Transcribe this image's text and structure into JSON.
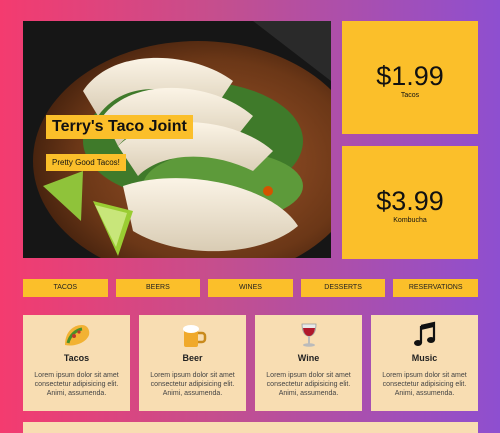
{
  "hero": {
    "title": "Terry's Taco Joint",
    "subtitle": "Pretty Good Tacos!"
  },
  "prices": [
    {
      "value": "$1.99",
      "label": "Tacos"
    },
    {
      "value": "$3.99",
      "label": "Kombucha"
    }
  ],
  "nav": {
    "items": [
      "TACOS",
      "BEERS",
      "WINES",
      "DESSERTS",
      "RESERVATIONS"
    ]
  },
  "cards": [
    {
      "icon": "taco-icon",
      "title": "Tacos",
      "text": "Lorem ipsum dolor sit amet consectetur adipisicing elit. Animi, assumenda."
    },
    {
      "icon": "beer-mug-icon",
      "title": "Beer",
      "text": "Lorem ipsum dolor sit amet consectetur adipisicing elit. Animi, assumenda."
    },
    {
      "icon": "wine-glass-icon",
      "title": "Wine",
      "text": "Lorem ipsum dolor sit amet consectetur adipisicing elit. Animi, assumenda."
    },
    {
      "icon": "music-note-icon",
      "title": "Music",
      "text": "Lorem ipsum dolor sit amet consectetur adipisicing elit. Animi, assumenda."
    }
  ],
  "colors": {
    "accent": "#fbbf2a",
    "card_bg": "#f8ddb2",
    "gradient_left": "#f43b6f",
    "gradient_right": "#8e4fd0"
  }
}
